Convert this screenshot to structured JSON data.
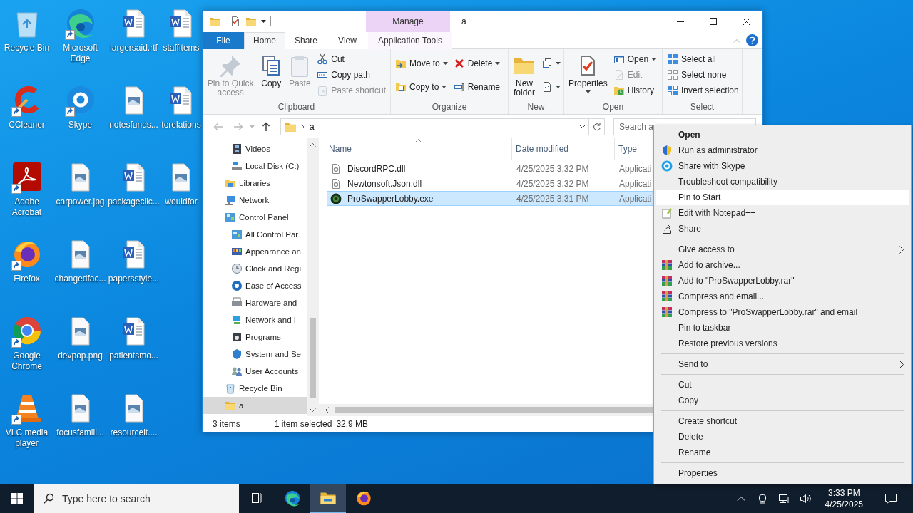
{
  "desktop": {
    "icons": [
      {
        "label": "Recycle Bin",
        "kind": "recycle",
        "shortcut": false
      },
      {
        "label": "CCleaner",
        "kind": "ccleaner",
        "shortcut": true
      },
      {
        "label": "Adobe Acrobat",
        "kind": "acrobat",
        "shortcut": true
      },
      {
        "label": "Firefox",
        "kind": "firefox",
        "shortcut": true
      },
      {
        "label": "Google Chrome",
        "kind": "chrome",
        "shortcut": true
      },
      {
        "label": "VLC media player",
        "kind": "vlc",
        "shortcut": true
      },
      {
        "label": "Microsoft Edge",
        "kind": "edge",
        "shortcut": true
      },
      {
        "label": "Skype",
        "kind": "skype",
        "shortcut": true
      },
      {
        "label": "carpower.jpg",
        "kind": "image",
        "shortcut": false
      },
      {
        "label": "changedfac...",
        "kind": "image",
        "shortcut": false
      },
      {
        "label": "devpop.png",
        "kind": "image",
        "shortcut": false
      },
      {
        "label": "focusfamili...",
        "kind": "image",
        "shortcut": false
      },
      {
        "label": "largersaid.rtf",
        "kind": "word",
        "shortcut": false
      },
      {
        "label": "notesfunds...",
        "kind": "image",
        "shortcut": false
      },
      {
        "label": "packageclic...",
        "kind": "word",
        "shortcut": false
      },
      {
        "label": "papersstyle...",
        "kind": "word",
        "shortcut": false
      },
      {
        "label": "patientsmo...",
        "kind": "word",
        "shortcut": false
      },
      {
        "label": "resourceit....",
        "kind": "image",
        "shortcut": false
      },
      {
        "label": "staffitems",
        "kind": "word",
        "shortcut": false
      },
      {
        "label": "torelations",
        "kind": "word",
        "shortcut": false
      },
      {
        "label": "wouldfor",
        "kind": "image",
        "shortcut": false
      }
    ]
  },
  "explorer": {
    "title": "a",
    "contextual_header": "Manage",
    "tabs": [
      {
        "label": "File",
        "kind": "file",
        "selected": false
      },
      {
        "label": "Home",
        "kind": "normal",
        "selected": true
      },
      {
        "label": "Share",
        "kind": "normal",
        "selected": false
      },
      {
        "label": "View",
        "kind": "normal",
        "selected": false
      },
      {
        "label": "Application Tools",
        "kind": "contextual",
        "selected": false
      }
    ],
    "ribbon": {
      "groups": [
        {
          "label": "Clipboard",
          "columns": [
            [
              {
                "label": "Pin to Quick access",
                "kind": "large",
                "disabled": true,
                "dropdown": false
              }
            ],
            [
              {
                "label": "Copy",
                "kind": "large",
                "disabled": false,
                "dropdown": false
              }
            ],
            [
              {
                "label": "Paste",
                "kind": "large",
                "disabled": true,
                "dropdown": false
              }
            ],
            [
              {
                "label": "Cut",
                "kind": "small",
                "disabled": false,
                "dropdown": false
              },
              {
                "label": "Copy path",
                "kind": "small",
                "disabled": false,
                "dropdown": false
              },
              {
                "label": "Paste shortcut",
                "kind": "small",
                "disabled": true,
                "dropdown": false
              }
            ]
          ]
        },
        {
          "label": "Organize",
          "columns": [
            [
              {
                "label": "Move to",
                "kind": "small",
                "disabled": false,
                "dropdown": true
              },
              {
                "label": "Copy to",
                "kind": "small",
                "disabled": false,
                "dropdown": true
              }
            ],
            [
              {
                "label": "Delete",
                "kind": "small",
                "disabled": false,
                "dropdown": true
              },
              {
                "label": "Rename",
                "kind": "small",
                "disabled": false,
                "dropdown": false
              }
            ]
          ]
        },
        {
          "label": "New",
          "columns": [
            [
              {
                "label": "New folder",
                "kind": "large",
                "disabled": false,
                "dropdown": false
              }
            ],
            [
              {
                "kind": "small",
                "disabled": false,
                "dropdown": true
              },
              {
                "kind": "small",
                "disabled": false,
                "dropdown": true
              }
            ]
          ]
        },
        {
          "label": "Open",
          "columns": [
            [
              {
                "label": "Properties",
                "kind": "large",
                "disabled": false,
                "dropdown": true
              }
            ],
            [
              {
                "label": "Open",
                "kind": "small",
                "disabled": false,
                "dropdown": true
              },
              {
                "label": "Edit",
                "kind": "small",
                "disabled": true,
                "dropdown": false
              },
              {
                "label": "History",
                "kind": "small",
                "disabled": false,
                "dropdown": false
              }
            ]
          ]
        },
        {
          "label": "Select",
          "columns": [
            [
              {
                "label": "Select all",
                "kind": "small",
                "disabled": false,
                "dropdown": false
              },
              {
                "label": "Select none",
                "kind": "small",
                "disabled": false,
                "dropdown": false
              },
              {
                "label": "Invert selection",
                "kind": "small",
                "disabled": false,
                "dropdown": false
              }
            ]
          ]
        }
      ]
    },
    "address": {
      "path": [
        "a"
      ]
    },
    "search": {
      "placeholder": "Search a"
    },
    "nav_pane": {
      "continued_items": [
        {
          "label": "Videos",
          "selected": false
        },
        {
          "label": "Local Disk (C:)",
          "selected": false
        }
      ],
      "items": [
        {
          "label": "Libraries",
          "selected": false
        },
        {
          "label": "Network",
          "selected": false
        },
        {
          "label": "Control Panel",
          "selected": false,
          "children": [
            {
              "label": "All Control Par",
              "selected": false
            },
            {
              "label": "Appearance an",
              "selected": false
            },
            {
              "label": "Clock and Regi",
              "selected": false
            },
            {
              "label": "Ease of Access",
              "selected": false
            },
            {
              "label": "Hardware and",
              "selected": false
            },
            {
              "label": "Network and I",
              "selected": false
            },
            {
              "label": "Programs",
              "selected": false
            },
            {
              "label": "System and Se",
              "selected": false
            },
            {
              "label": "User Accounts",
              "selected": false
            }
          ]
        },
        {
          "label": "Recycle Bin",
          "selected": false
        },
        {
          "label": "a",
          "selected": true
        }
      ]
    },
    "file_list": {
      "columns": [
        "Name",
        "Date modified",
        "Type"
      ],
      "rows": [
        {
          "name": "DiscordRPC.dll",
          "date": "4/25/2025 3:32 PM",
          "type": "Applicati",
          "kind": "dll",
          "selected": false
        },
        {
          "name": "Newtonsoft.Json.dll",
          "date": "4/25/2025 3:32 PM",
          "type": "Applicati",
          "kind": "dll",
          "selected": false
        },
        {
          "name": "ProSwapperLobby.exe",
          "date": "4/25/2025 3:31 PM",
          "type": "Applicati",
          "kind": "exe",
          "selected": true
        }
      ]
    },
    "status_bar": {
      "item_count": "3 items",
      "selection": "1 item selected",
      "size": "32.9 MB"
    }
  },
  "context_menu": {
    "items": [
      {
        "kind": "item",
        "label": "Open",
        "default": true,
        "selected": false,
        "submenu": false
      },
      {
        "kind": "item",
        "label": "Run as administrator",
        "default": false,
        "selected": false,
        "submenu": false
      },
      {
        "kind": "item",
        "label": "Share with Skype",
        "default": false,
        "selected": false,
        "submenu": false
      },
      {
        "kind": "item",
        "label": "Troubleshoot compatibility",
        "default": false,
        "selected": false,
        "submenu": false
      },
      {
        "kind": "item",
        "label": "Pin to Start",
        "default": false,
        "selected": true,
        "submenu": false
      },
      {
        "kind": "item",
        "label": "Edit with Notepad++",
        "default": false,
        "selected": false,
        "submenu": false
      },
      {
        "kind": "item",
        "label": "Share",
        "default": false,
        "selected": false,
        "submenu": false
      },
      {
        "kind": "separator"
      },
      {
        "kind": "item",
        "label": "Give access to",
        "default": false,
        "selected": false,
        "submenu": true
      },
      {
        "kind": "item",
        "label": "Add to archive...",
        "default": false,
        "selected": false,
        "submenu": false
      },
      {
        "kind": "item",
        "label": "Add to \"ProSwapperLobby.rar\"",
        "default": false,
        "selected": false,
        "submenu": false
      },
      {
        "kind": "item",
        "label": "Compress and email...",
        "default": false,
        "selected": false,
        "submenu": false
      },
      {
        "kind": "item",
        "label": "Compress to \"ProSwapperLobby.rar\" and email",
        "default": false,
        "selected": false,
        "submenu": false
      },
      {
        "kind": "item",
        "label": "Pin to taskbar",
        "default": false,
        "selected": false,
        "submenu": false
      },
      {
        "kind": "item",
        "label": "Restore previous versions",
        "default": false,
        "selected": false,
        "submenu": false
      },
      {
        "kind": "separator"
      },
      {
        "kind": "item",
        "label": "Send to",
        "default": false,
        "selected": false,
        "submenu": true
      },
      {
        "kind": "separator"
      },
      {
        "kind": "item",
        "label": "Cut",
        "default": false,
        "selected": false,
        "submenu": false
      },
      {
        "kind": "item",
        "label": "Copy",
        "default": false,
        "selected": false,
        "submenu": false
      },
      {
        "kind": "separator"
      },
      {
        "kind": "item",
        "label": "Create shortcut",
        "default": false,
        "selected": false,
        "submenu": false
      },
      {
        "kind": "item",
        "label": "Delete",
        "default": false,
        "selected": false,
        "submenu": false
      },
      {
        "kind": "item",
        "label": "Rename",
        "default": false,
        "selected": false,
        "submenu": false
      },
      {
        "kind": "separator"
      },
      {
        "kind": "item",
        "label": "Properties",
        "default": false,
        "selected": false,
        "submenu": false
      }
    ]
  },
  "taskbar": {
    "search": {
      "placeholder": "Type here to search"
    },
    "apps": [
      {
        "kind": "taskview",
        "active": false
      },
      {
        "kind": "edge",
        "active": false
      },
      {
        "kind": "explorer",
        "active": true
      },
      {
        "kind": "firefox",
        "active": false
      }
    ],
    "clock": {
      "time": "3:33 PM",
      "date": "4/25/2025"
    }
  }
}
